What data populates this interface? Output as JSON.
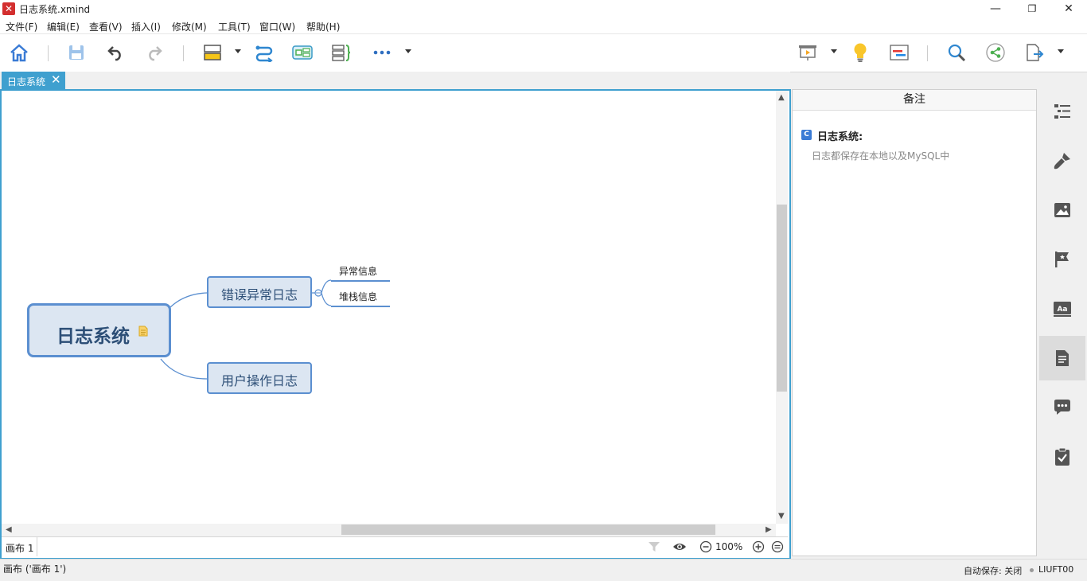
{
  "window": {
    "title": "日志系统.xmind",
    "minimize": "—",
    "restore": "❐",
    "close": "✕"
  },
  "menu": [
    "文件(F)",
    "编辑(E)",
    "查看(V)",
    "插入(I)",
    "修改(M)",
    "工具(T)",
    "窗口(W)",
    "帮助(H)"
  ],
  "tab": {
    "label": "日志系统",
    "close": "✕"
  },
  "mindmap": {
    "central": "日志系统",
    "topics": [
      {
        "label": "错误异常日志",
        "subtopics": [
          "异常信息",
          "堆栈信息"
        ]
      },
      {
        "label": "用户操作日志",
        "subtopics": []
      }
    ]
  },
  "canvas_bar": {
    "sheet": "画布 1",
    "zoom": "100%"
  },
  "notes": {
    "header": "备注",
    "badge": "C",
    "title": "日志系统:",
    "text": "日志都保存在本地以及MySQL中"
  },
  "status": {
    "left": "画布 ('画布 1')",
    "autosave": "自动保存: 关闭",
    "user": "LIUFT00"
  },
  "colors": {
    "accent": "#3fa0cf",
    "topic_border": "#5b8fd0",
    "topic_fill": "#dce6f2",
    "topic_text": "#2d4f77"
  }
}
